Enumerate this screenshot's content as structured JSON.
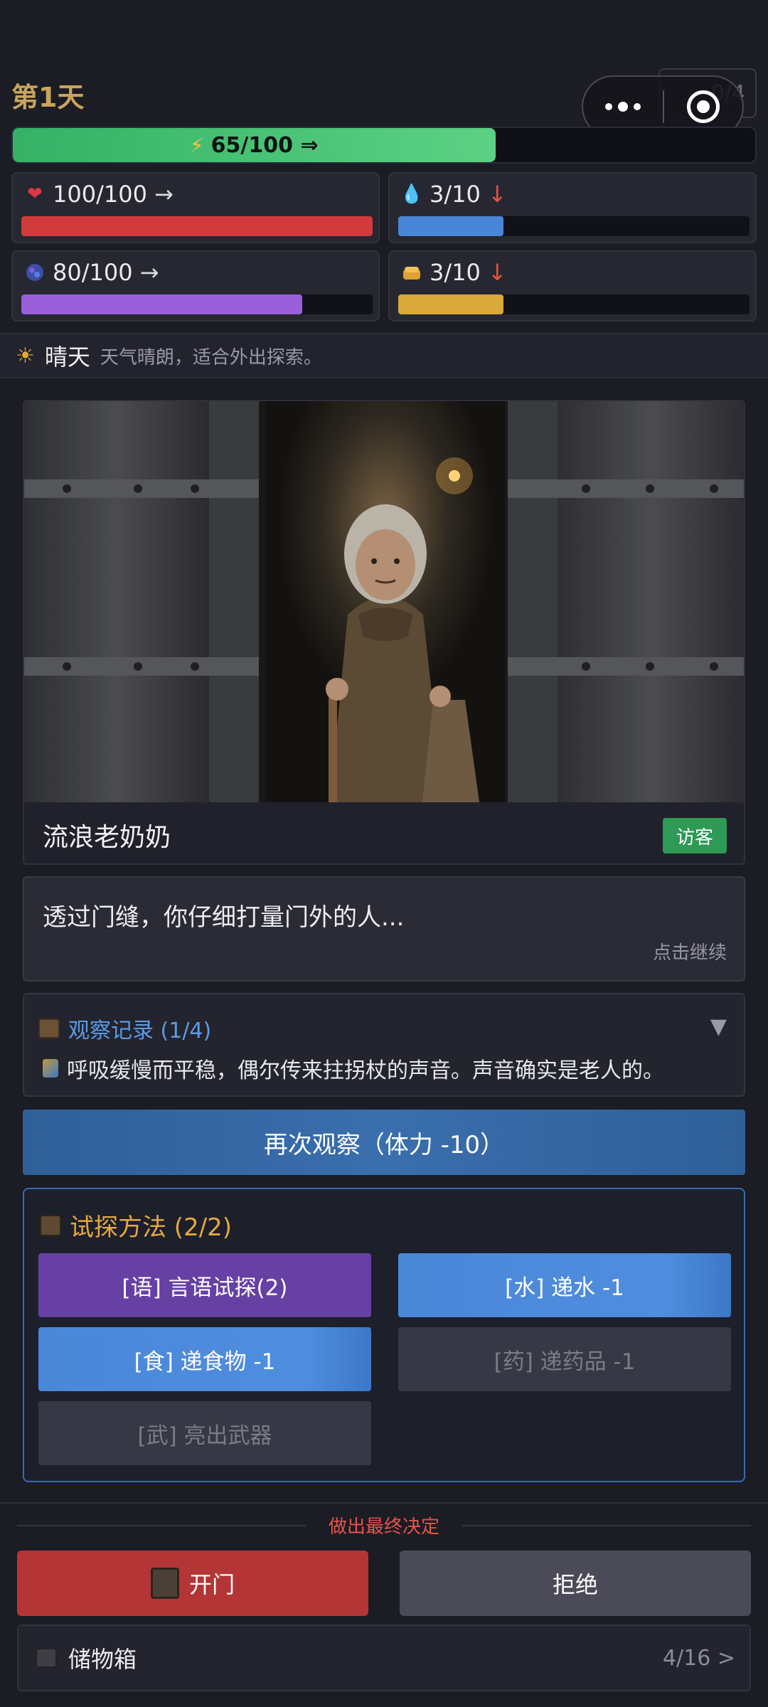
{
  "header": {
    "day": "第1天",
    "hidden_counter": "0/4"
  },
  "energy": {
    "label": "65/100 ⇒",
    "value": 65,
    "max": 100
  },
  "stats": {
    "health": {
      "label": "100/100",
      "arrow": "→",
      "value": 100,
      "max": 100,
      "color": "#d23b3b",
      "icon": "heart-icon"
    },
    "water": {
      "label": "3/10",
      "arrow": "↓",
      "value": 3,
      "max": 10,
      "color": "#4a86d8",
      "icon": "water-drop-icon"
    },
    "sanity": {
      "label": "80/100",
      "arrow": "→",
      "value": 80,
      "max": 100,
      "color": "#9a5fdb",
      "icon": "brain-orb-icon"
    },
    "food": {
      "label": "3/10",
      "arrow": "↓",
      "value": 3,
      "max": 10,
      "color": "#d9a93a",
      "icon": "bread-icon"
    }
  },
  "weather": {
    "name": "晴天",
    "description": "天气晴朗，适合外出探索。"
  },
  "visitor": {
    "name": "流浪老奶奶",
    "tag": "访客"
  },
  "dialog": {
    "text": "透过门缝，你仔细打量门外的人...",
    "hint": "点击继续"
  },
  "observation": {
    "title": "观察记录 (1/4)",
    "toggle": "▼",
    "entry": "呼吸缓慢而平稳，偶尔传来拄拐杖的声音。声音确实是老人的。"
  },
  "reobserve_label": "再次观察（体力 -10）",
  "probe": {
    "title": "试探方法 (2/2)",
    "buttons": [
      {
        "label": "[语] 言语试探(2)"
      },
      {
        "label": "[水] 递水 -1"
      },
      {
        "label": "[食] 递食物 -1"
      },
      {
        "label": "[药] 递药品 -1"
      },
      {
        "label": "[武] 亮出武器"
      }
    ]
  },
  "decision": {
    "label": "做出最终决定",
    "open": "开门",
    "refuse": "拒绝"
  },
  "storage": {
    "label": "储物箱",
    "count": "4/16 >"
  }
}
